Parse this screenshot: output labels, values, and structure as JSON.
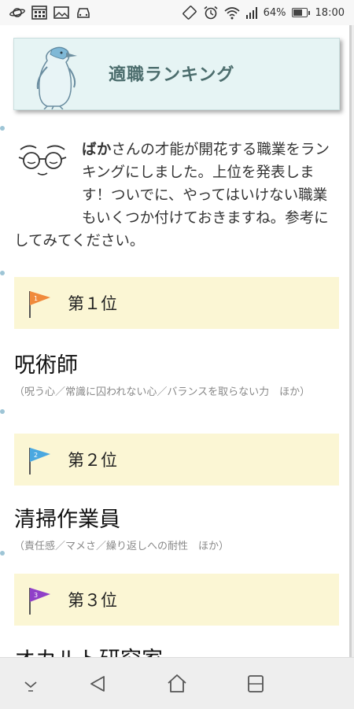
{
  "status_bar": {
    "battery": "64%",
    "battery_level": 0.64,
    "time": "18:00",
    "left_icons": [
      "saturn-icon",
      "calendar-icon",
      "image-icon",
      "car-icon"
    ],
    "right_icons": [
      "rotate-icon",
      "alarm-icon",
      "wifi-icon",
      "signal-icon",
      "battery-icon"
    ]
  },
  "banner": {
    "title": "適職ランキング"
  },
  "intro": {
    "name": "ばか",
    "text": "さんの才能が開花する職業をランキングにしました。上位を発表します！ついでに、やってはいけない職業もいくつか付けておきますね。参考にしてみてください。"
  },
  "rankings": [
    {
      "rank_label": "第１位",
      "flag_color": "#f08a3c",
      "flag_number": "1",
      "job": "呪術師",
      "traits": "（呪う心／常識に囚われない心／バランスを取らない力　ほか）"
    },
    {
      "rank_label": "第２位",
      "flag_color": "#4aa8e0",
      "flag_number": "2",
      "job": "清掃作業員",
      "traits": "（責任感／マメさ／繰り返しへの耐性　ほか）"
    },
    {
      "rank_label": "第３位",
      "flag_color": "#9040c8",
      "flag_number": "3",
      "job": "オカルト研究家",
      "traits": ""
    }
  ],
  "nav": {
    "icons": [
      "chevron-down-icon",
      "back-icon",
      "home-icon",
      "recents-icon"
    ]
  }
}
